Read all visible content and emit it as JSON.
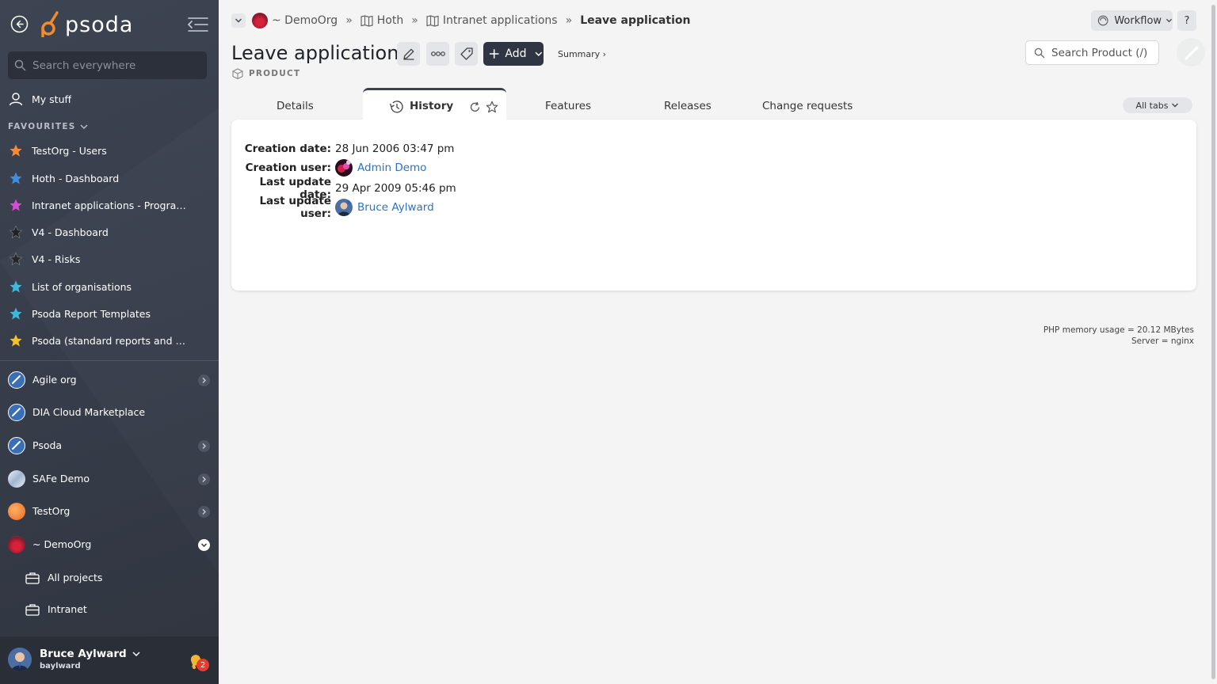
{
  "sidebar": {
    "logo_text": "psoda",
    "search_placeholder": "Search everywhere",
    "my_stuff": "My stuff",
    "favourites_header": "FAVOURITES",
    "favourites": [
      {
        "label": "TestOrg - Users",
        "color": "#f28c3c"
      },
      {
        "label": "Hoth - Dashboard",
        "color": "#3d8fe0"
      },
      {
        "label": "Intranet applications - Programme...",
        "color": "#d94bd6"
      },
      {
        "label": "V4 - Dashboard",
        "color": "#222222"
      },
      {
        "label": "V4 - Risks",
        "color": "#222222"
      },
      {
        "label": "List of organisations",
        "color": "#3fb8d8"
      },
      {
        "label": "Psoda Report Templates",
        "color": "#3fb8d8"
      },
      {
        "label": "Psoda (standard reports and work...",
        "color": "#f2c230"
      }
    ],
    "orgs": [
      {
        "label": "Agile org",
        "expand": "collapsed"
      },
      {
        "label": "DIA Cloud Marketplace",
        "expand": "none"
      },
      {
        "label": "Psoda",
        "expand": "collapsed"
      },
      {
        "label": "SAFe Demo",
        "expand": "collapsed"
      },
      {
        "label": "TestOrg",
        "expand": "collapsed"
      },
      {
        "label": "~ DemoOrg",
        "expand": "expanded"
      }
    ],
    "sub_items": [
      {
        "label": "All projects"
      },
      {
        "label": "Intranet"
      }
    ],
    "user": {
      "name": "Bruce Aylward",
      "username": "baylward",
      "notifications": "2"
    }
  },
  "breadcrumb": [
    {
      "label": "~ DemoOrg"
    },
    {
      "label": "Hoth"
    },
    {
      "label": "Intranet applications"
    },
    {
      "label": "Leave application"
    }
  ],
  "header": {
    "title": "Leave application",
    "add_label": "Add",
    "summary_label": "Summary ›",
    "type_label": "PRODUCT",
    "workflow_label": "Workflow",
    "help_label": "?",
    "search_placeholder": "Search Product (/)"
  },
  "tabs": [
    {
      "label": "Details"
    },
    {
      "label": "History",
      "active": true
    },
    {
      "label": "Features"
    },
    {
      "label": "Releases"
    },
    {
      "label": "Change requests"
    }
  ],
  "all_tabs_label": "All tabs",
  "history": {
    "creation_date_label": "Creation date:",
    "creation_date": "28 Jun 2006 03:47 pm",
    "creation_user_label": "Creation user:",
    "creation_user": "Admin Demo",
    "last_update_date_label": "Last update date:",
    "last_update_date": "29 Apr 2009 05:46 pm",
    "last_update_user_label": "Last update user:",
    "last_update_user": "Bruce Aylward"
  },
  "footer": {
    "memory": "PHP memory usage = 20.12 MBytes",
    "server": "Server = nginx"
  }
}
